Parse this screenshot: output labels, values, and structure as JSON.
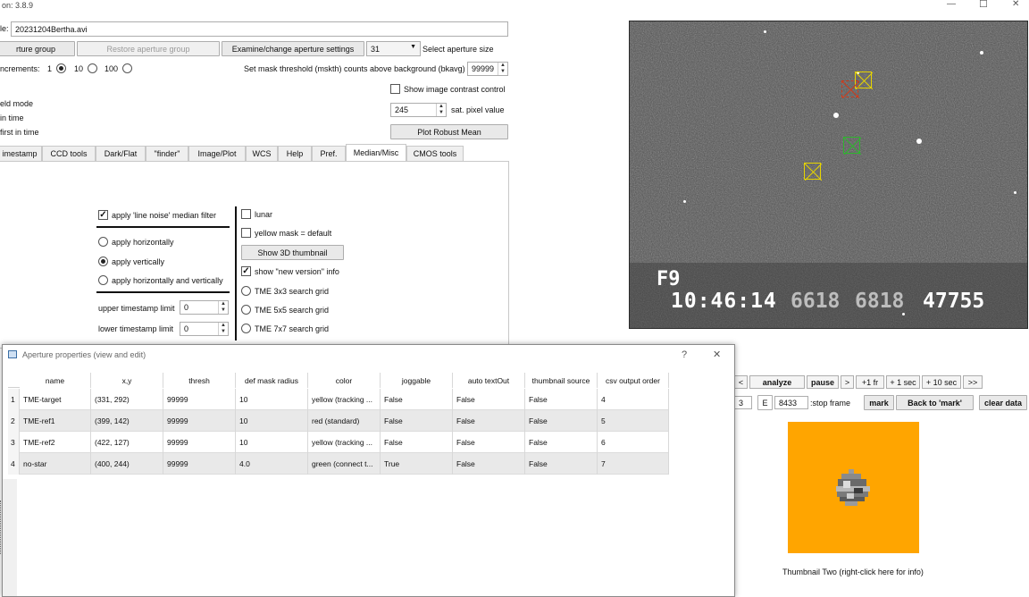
{
  "window": {
    "title": "on: 3.8.9",
    "minimize_glyph": "—",
    "maximize_glyph": "☐",
    "close_glyph": "✕"
  },
  "file": {
    "label": "le:",
    "value": "20231204Bertha.avi"
  },
  "aperture_controls": {
    "group_button": "rture group",
    "restore_button": "Restore aperture group",
    "examine_button": "Examine/change aperture settings",
    "size_value": "31",
    "size_label": "Select aperture size"
  },
  "increments": {
    "label": "ncrements:",
    "options": [
      "1",
      "10",
      "100"
    ],
    "selected": "1"
  },
  "mask_threshold": {
    "label": "Set mask threshold (mskth) counts above background (bkavg)",
    "value": "99999"
  },
  "contrast": {
    "label": "Show image contrast control",
    "checked": false
  },
  "left_fragments": [
    "eld mode",
    "in time",
    "first in time"
  ],
  "saturation": {
    "value": "245",
    "label": "sat. pixel value"
  },
  "plot_robust_mean": "Plot Robust Mean",
  "tabs": [
    "imestamp",
    "CCD tools",
    "Dark/Flat",
    "\"finder\"",
    "Image/Plot",
    "WCS",
    "Help",
    "Pref.",
    "Median/Misc",
    "CMOS tools"
  ],
  "active_tab": "Median/Misc",
  "median_panel": {
    "line_noise_label": "apply 'line noise' median filter",
    "line_noise_checked": true,
    "radio_options": [
      "apply horizontally",
      "apply vertically",
      "apply horizontally and vertically"
    ],
    "radio_selected": "apply vertically",
    "upper_limit_label": "upper timestamp limit",
    "upper_limit_value": "0",
    "lower_limit_label": "lower timestamp limit",
    "lower_limit_value": "0",
    "lunar_label": "lunar",
    "lunar_checked": false,
    "yellow_mask_label": "yellow mask = default",
    "yellow_mask_checked": false,
    "show_3d_button": "Show 3D thumbnail",
    "new_version_label": "show \"new version\" info",
    "new_version_checked": true,
    "tme_options": [
      "TME 3x3 search grid",
      "TME 5x5 search grid",
      "TME 7x7 search grid"
    ]
  },
  "video_frame": {
    "overlay_line1": "F9",
    "timestamp": "10:46:14",
    "num1": "6618",
    "num2": "6818",
    "num3": "47755"
  },
  "nav": {
    "prev": "<",
    "analyze": "analyze",
    "pause": "pause",
    "next": ">",
    "plus1fr": "+1 fr",
    "plus1sec": "+ 1 sec",
    "plus10sec": "+ 10 sec",
    "ffwd": ">>"
  },
  "frame_row": {
    "start_value": "3",
    "e_label": "E",
    "stop_value": "8433",
    "stop_label": ":stop frame",
    "mark": "mark",
    "back_to_mark": "Back to 'mark'",
    "clear_data": "clear data"
  },
  "thumbnail": {
    "caption": "Thumbnail Two (right-click here for info)",
    "bg_color": "#ffa500"
  },
  "aperture_dialog": {
    "title": "Aperture properties (view and edit)",
    "help_glyph": "?",
    "close_glyph": "✕",
    "columns": [
      "name",
      "x,y",
      "thresh",
      "def mask radius",
      "color",
      "joggable",
      "auto textOut",
      "thumbnail source",
      "csv output order"
    ],
    "rows": [
      {
        "idx": "1",
        "cells": [
          "TME-target",
          "(331, 292)",
          "99999",
          "10",
          "yellow (tracking ...",
          "False",
          "False",
          "False",
          "4"
        ]
      },
      {
        "idx": "2",
        "cells": [
          "TME-ref1",
          "(399, 142)",
          "99999",
          "10",
          "red (standard)",
          "False",
          "False",
          "False",
          "5"
        ]
      },
      {
        "idx": "3",
        "cells": [
          "TME-ref2",
          "(422, 127)",
          "99999",
          "10",
          "yellow (tracking ...",
          "False",
          "False",
          "False",
          "6"
        ]
      },
      {
        "idx": "4",
        "cells": [
          "no-star",
          "(400, 244)",
          "99999",
          "4.0",
          "green (connect t...",
          "True",
          "False",
          "False",
          "7"
        ]
      }
    ]
  },
  "colors": {
    "aperture_yellow": "#e6d400",
    "aperture_red": "#d03a1a",
    "aperture_green": "#2fb52f",
    "thumbnail_orange": "#ffa500"
  }
}
